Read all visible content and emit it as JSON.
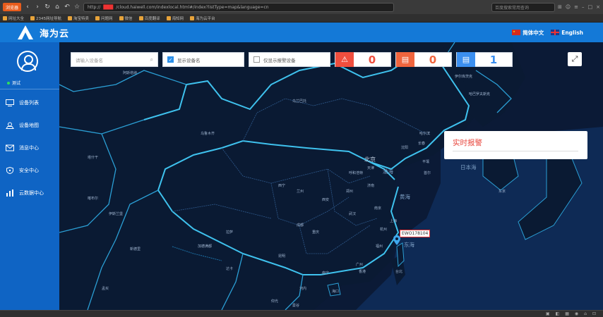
{
  "browser": {
    "logo_label": "浏览器",
    "url_prefix": "http://",
    "url_redacted": "███",
    "url_rest": "/cloud.haiwell.com/indexlocal.html#/index?listType=map&language=cn",
    "search_placeholder": "百度搜索常用查询",
    "bookmarks": [
      "网址大全",
      "2345网址导航",
      "淘宝特卖",
      "问题网",
      "微信",
      "百度翻译",
      "海知网",
      "海为云平台"
    ]
  },
  "header": {
    "title": "海为云",
    "lang_cn": "简体中文",
    "lang_en": "English"
  },
  "sidebar": {
    "user_name": "测试",
    "items": [
      {
        "label": "设备列表",
        "icon": "monitor-icon"
      },
      {
        "label": "设备地图",
        "icon": "map-pin-icon"
      },
      {
        "label": "消息中心",
        "icon": "envelope-icon"
      },
      {
        "label": "安全中心",
        "icon": "shield-icon"
      },
      {
        "label": "云数据中心",
        "icon": "bar-chart-icon"
      }
    ]
  },
  "toolbar": {
    "search_placeholder": "请输入设备名",
    "show_names_label": "显示设备名",
    "show_alarm_only_label": "仅显示报警设备",
    "alarm_count": "0",
    "offline_count": "0",
    "online_count": "1",
    "colors": {
      "alarm": "#ef4e3e",
      "offline": "#f0653e",
      "online": "#3b8ff0"
    }
  },
  "alarm_panel": {
    "title": "实时报警"
  },
  "device": {
    "name": "EWO178104"
  },
  "map": {
    "labels": {
      "ulaanbaatar": "乌兰巴托",
      "urumqi": "乌鲁木齐",
      "beijing": "北京",
      "tianjin": "天津",
      "shenyang": "沈阳",
      "bohai": "渤海",
      "sea_of_japan": "日本海",
      "yellow_sea": "黄海",
      "east_sea": "东海",
      "shanghai": "上海",
      "taipei": "台北",
      "guangzhou": "广州",
      "hongkong": "香港",
      "chongqing": "重庆",
      "chengdu": "成都",
      "wuhan": "武汉",
      "xian": "西安",
      "lanzhou": "兰州",
      "xining": "西宁",
      "lhasa": "拉萨",
      "kunming": "昆明",
      "nanning": "南宁",
      "haikou": "海口",
      "new_delhi": "新德里",
      "kathmandu": "加德满都",
      "dhaka": "达卡",
      "mumbai": "孟买",
      "astana": "阿斯塔纳",
      "tashkent": "塔什干",
      "kabul": "喀布尔",
      "islamabad": "伊斯兰堡",
      "harbin": "哈尔滨",
      "changchun": "长春",
      "hohhot": "呼和浩特",
      "zhengzhou": "郑州",
      "jinan": "济南",
      "nanjing": "南京",
      "hangzhou": "杭州",
      "fuzhou": "福州",
      "hanoi": "河内",
      "bangkok": "曼谷",
      "yangon": "仰光",
      "seoul": "首尔",
      "pyongyang": "平壤",
      "tokyo": "东京",
      "irkutsk": "伊尔库茨克",
      "khabarovsk": "哈巴罗夫斯克"
    }
  }
}
